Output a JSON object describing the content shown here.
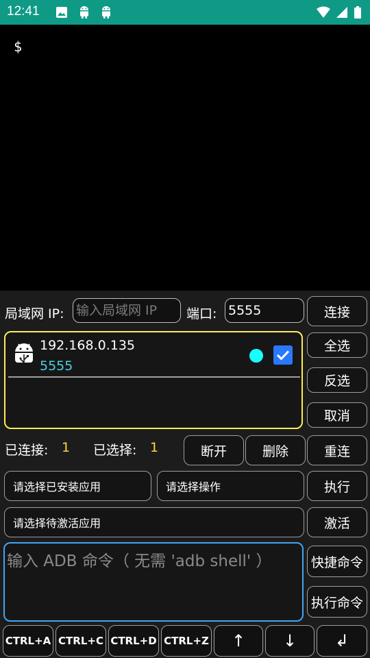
{
  "status_bar": {
    "time": "12:41",
    "left_icons": [
      "image-icon",
      "android-icon",
      "android-icon"
    ],
    "right_icons": [
      "wifi-icon",
      "signal-icon",
      "battery-icon"
    ]
  },
  "terminal": {
    "prompt": "$"
  },
  "connect_row": {
    "lan_ip_label": "局域网 IP:",
    "ip_placeholder": "输入局域网 IP",
    "port_label": "端口:",
    "port_value": "5555",
    "connect_button": "连接"
  },
  "device_list": [
    {
      "ip": "192.168.0.135",
      "port": "5555",
      "online": true,
      "selected": true
    }
  ],
  "side_buttons": {
    "select_all": "全选",
    "invert": "反选",
    "cancel": "取消",
    "reconnect": "重连"
  },
  "stats": {
    "connected_label": "已连接:",
    "connected_count": "1",
    "selected_label": "已选择:",
    "selected_count": "1",
    "disconnect_button": "断开",
    "delete_button": "删除"
  },
  "app_ops": {
    "installed_app_select": "请选择已安装应用",
    "operation_select": "请选择操作",
    "execute_button": "执行",
    "activate_app_select": "请选择待激活应用",
    "activate_button": "激活"
  },
  "command": {
    "placeholder": "输入 ADB 命令（ 无需 'adb shell' ）",
    "shortcut_button": "快捷命令",
    "run_button": "执行命令"
  },
  "keys": [
    "CTRL+A",
    "CTRL+C",
    "CTRL+D",
    "CTRL+Z",
    "↑",
    "↓",
    "↲"
  ],
  "colors": {
    "status_bar": "#0f9a86",
    "device_border": "#ffee58",
    "count_color": "#ffd740",
    "port_color": "#4dd0e1",
    "online_dot": "#18ffff",
    "checkbox": "#2979ff",
    "command_border": "#42a5f5"
  }
}
